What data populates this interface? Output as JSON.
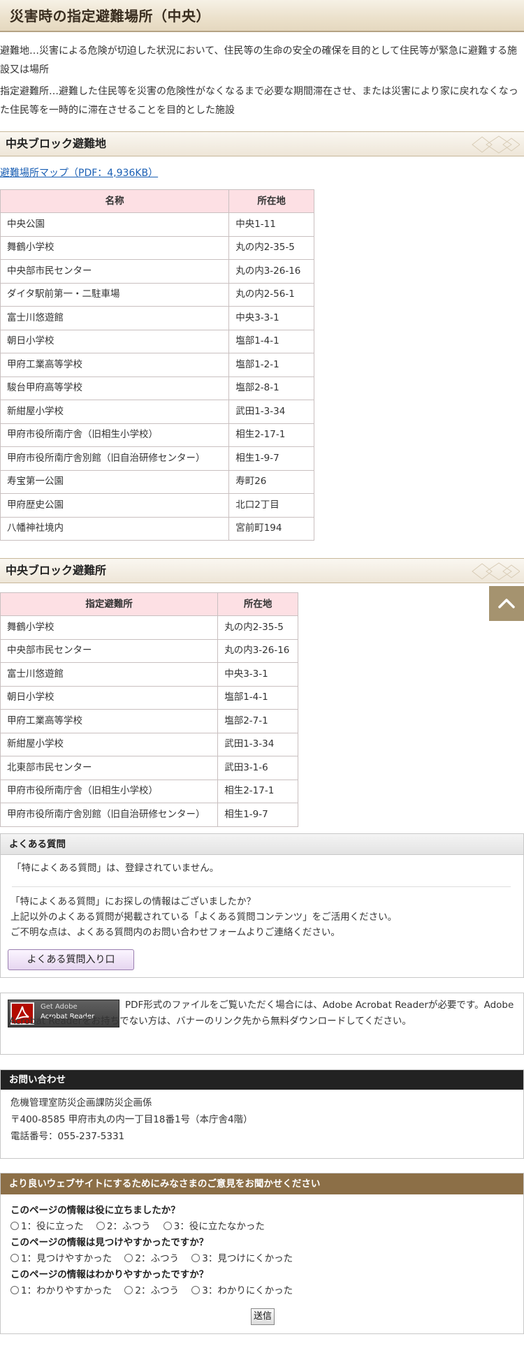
{
  "page": {
    "title": "災害時の指定避難場所（中央）",
    "intro": [
      "避難地…災害による危険が切迫した状況において、住民等の生命の安全の確保を目的として住民等が緊急に避難する施設又は場所",
      "指定避難所…避難した住民等を災害の危険性がなくなるまで必要な期間滞在させ、または災害により家に戻れなくなった住民等を一時的に滞在させることを目的とした施設"
    ]
  },
  "section1": {
    "heading": "中央ブロック避難地",
    "pdf_link": "避難場所マップ（PDF：4,936KB）",
    "columns": [
      "名称",
      "所在地"
    ],
    "rows": [
      [
        "中央公園",
        "中央1-11"
      ],
      [
        "舞鶴小学校",
        "丸の内2-35-5"
      ],
      [
        "中央部市民センター",
        "丸の内3-26-16"
      ],
      [
        "ダイタ駅前第一・二駐車場",
        "丸の内2-56-1"
      ],
      [
        "富士川悠遊館",
        "中央3-3-1"
      ],
      [
        "朝日小学校",
        "塩部1-4-1"
      ],
      [
        "甲府工業高等学校",
        "塩部1-2-1"
      ],
      [
        "駿台甲府高等学校",
        "塩部2-8-1"
      ],
      [
        "新紺屋小学校",
        "武田1-3-34"
      ],
      [
        "甲府市役所南庁舎（旧相生小学校）",
        "相生2-17-1"
      ],
      [
        "甲府市役所南庁舎別館（旧自治研修センター）",
        "相生1-9-7"
      ],
      [
        "寿宝第一公園",
        "寿町26"
      ],
      [
        "甲府歴史公園",
        "北口2丁目"
      ],
      [
        "八幡神社境内",
        "宮前町194"
      ]
    ]
  },
  "section2": {
    "heading": "中央ブロック避難所",
    "columns": [
      "指定避難所",
      "所在地"
    ],
    "rows": [
      [
        "舞鶴小学校",
        "丸の内2-35-5"
      ],
      [
        "中央部市民センター",
        "丸の内3-26-16"
      ],
      [
        "富士川悠遊館",
        "中央3-3-1"
      ],
      [
        "朝日小学校",
        "塩部1-4-1"
      ],
      [
        "甲府工業高等学校",
        "塩部2-7-1"
      ],
      [
        "新紺屋小学校",
        "武田1-3-34"
      ],
      [
        "北東部市民センター",
        "武田3-1-6"
      ],
      [
        "甲府市役所南庁舎（旧相生小学校）",
        "相生2-17-1"
      ],
      [
        "甲府市役所南庁舎別館（旧自治研修センター）",
        "相生1-9-7"
      ]
    ]
  },
  "faq": {
    "heading": "よくある質問",
    "none_text": "「特によくある質問」は、登録されていません。",
    "lines": [
      "「特によくある質問」にお探しの情報はございましたか？",
      "上記以外のよくある質問が掲載されている「よくある質問コンテンツ」をご活用ください。",
      "ご不明な点は、よくある質問内のお問い合わせフォームよりご連絡ください。"
    ],
    "button": "よくある質問入り口"
  },
  "acrobat": {
    "banner_line1": "Get Adobe",
    "banner_line2": "Acrobat Reader",
    "text": "PDF形式のファイルをご覧いただく場合には、Adobe Acrobat Readerが必要です。Adobe Acrobat Readerをお持ちでない方は、バナーのリンク先から無料ダウンロードしてください。"
  },
  "contact": {
    "heading": "お問い合わせ",
    "dept": "危機管理室防災企画課防災企画係",
    "address": "〒400-8585 甲府市丸の内一丁目18番1号（本庁舎4階）",
    "phone": "電話番号：055-237-5331"
  },
  "survey": {
    "heading": "より良いウェブサイトにするためにみなさまのご意見をお聞かせください",
    "questions": [
      {
        "q": "このページの情報は役に立ちましたか？",
        "options": [
          "1：役に立った",
          "2：ふつう",
          "3：役に立たなかった"
        ]
      },
      {
        "q": "このページの情報は見つけやすかったですか？",
        "options": [
          "1：見つけやすかった",
          "2：ふつう",
          "3：見つけにくかった"
        ]
      },
      {
        "q": "このページの情報はわかりやすかったですか？",
        "options": [
          "1：わかりやすかった",
          "2：ふつう",
          "3：わかりにくかった"
        ]
      }
    ],
    "submit": "送信"
  },
  "colors": {
    "header_bg": "#ece2cd",
    "table_head_bg": "#fde0e4",
    "back_top_bg": "#a5936f",
    "survey_head_bg": "#8c6f47",
    "link": "#1a5fb4"
  },
  "icons": {
    "back_to_top": "chevron-up-icon",
    "acrobat": "acrobat-logo-icon"
  }
}
